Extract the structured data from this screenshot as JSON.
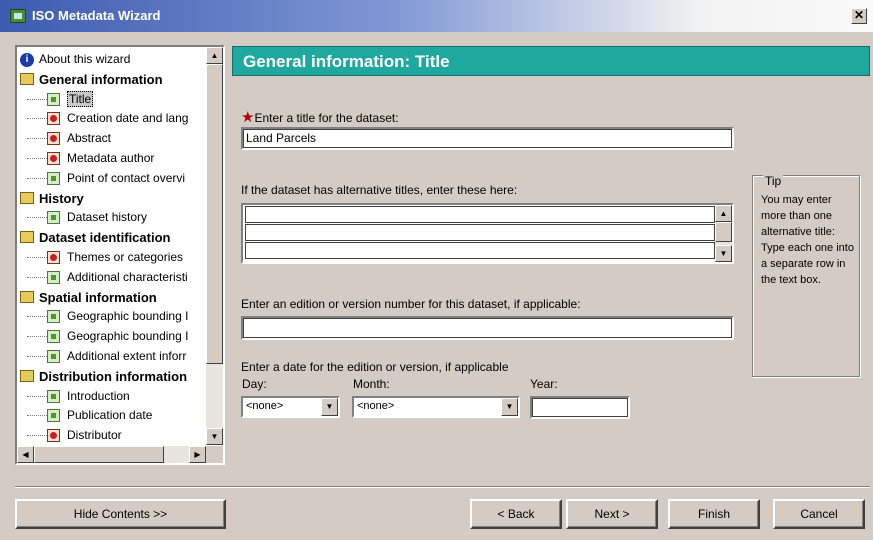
{
  "window": {
    "title": "ISO Metadata Wizard",
    "close_glyph": "✕"
  },
  "tree": {
    "items": [
      {
        "label": "About this wizard",
        "level": "info"
      },
      {
        "label": "General information",
        "level": "section"
      },
      {
        "label": "Title",
        "level": "page",
        "status": "ok",
        "selected": true
      },
      {
        "label": "Creation date and lang",
        "level": "page",
        "status": "required"
      },
      {
        "label": "Abstract",
        "level": "page",
        "status": "required"
      },
      {
        "label": "Metadata author",
        "level": "page",
        "status": "required"
      },
      {
        "label": "Point of contact overvi",
        "level": "page",
        "status": "ok"
      },
      {
        "label": "History",
        "level": "section"
      },
      {
        "label": "Dataset history",
        "level": "page",
        "status": "ok"
      },
      {
        "label": "Dataset identification",
        "level": "section"
      },
      {
        "label": "Themes or categories",
        "level": "page",
        "status": "required"
      },
      {
        "label": "Additional characteristi",
        "level": "page",
        "status": "ok"
      },
      {
        "label": "Spatial information",
        "level": "section"
      },
      {
        "label": "Geographic bounding I",
        "level": "page",
        "status": "ok"
      },
      {
        "label": "Geographic bounding I",
        "level": "page",
        "status": "ok"
      },
      {
        "label": "Additional extent inforr",
        "level": "page",
        "status": "ok"
      },
      {
        "label": "Distribution information",
        "level": "section"
      },
      {
        "label": "Introduction",
        "level": "page",
        "status": "ok"
      },
      {
        "label": "Publication date",
        "level": "page",
        "status": "ok"
      },
      {
        "label": "Distributor",
        "level": "page",
        "status": "required"
      }
    ]
  },
  "main": {
    "header": "General information: Title",
    "title_label": "Enter a title for the dataset:",
    "required_mark": "★",
    "title_value": "Land Parcels",
    "alt_titles_label": "If the dataset has alternative titles, enter these here:",
    "edition_label": "Enter an edition or version number for this dataset, if applicable:",
    "edition_value": "",
    "date_label": "Enter a date for the edition or version, if applicable",
    "day_label": "Day:",
    "month_label": "Month:",
    "year_label": "Year:",
    "day_value": "<none>",
    "month_value": "<none>",
    "year_value": ""
  },
  "tip": {
    "title": "Tip",
    "text": "You may enter more than one alternative title: Type each one into a separate row in the text box."
  },
  "buttons": {
    "hide_contents": "Hide Contents >>",
    "back": "< Back",
    "next": "Next >",
    "finish": "Finish",
    "cancel": "Cancel"
  },
  "glyphs": {
    "up": "▲",
    "down": "▼",
    "left": "◀",
    "right": "▶"
  }
}
